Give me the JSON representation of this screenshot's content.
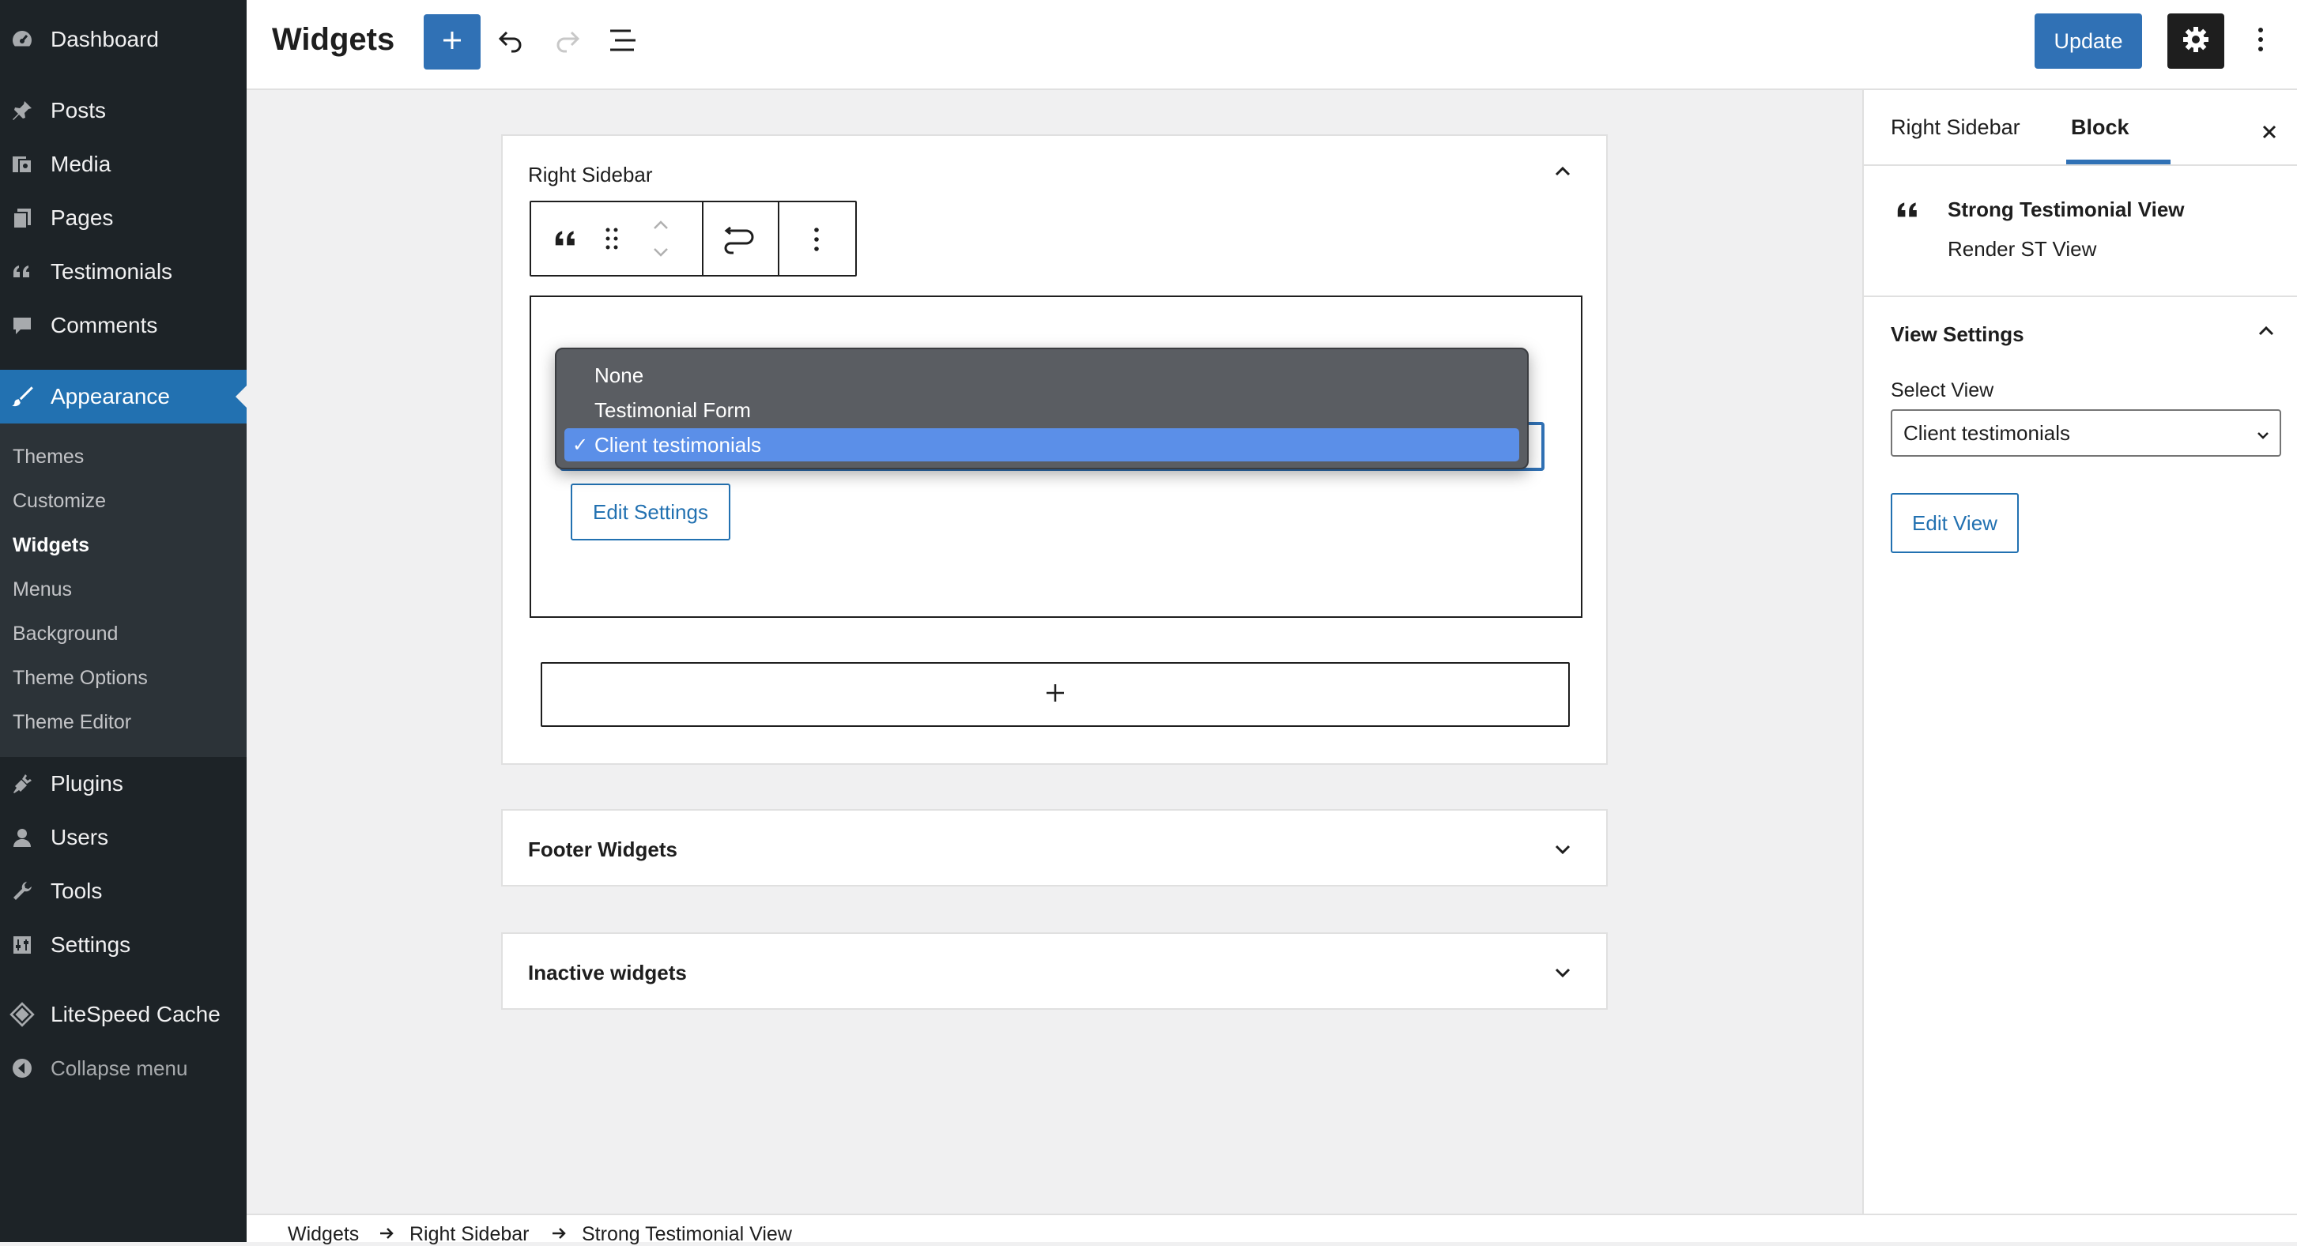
{
  "admin_menu": {
    "items": [
      {
        "label": "Dashboard",
        "icon": "dashboard-icon"
      },
      {
        "label": "Posts",
        "icon": "pin-icon"
      },
      {
        "label": "Media",
        "icon": "media-icon"
      },
      {
        "label": "Pages",
        "icon": "pages-icon"
      },
      {
        "label": "Testimonials",
        "icon": "quote-icon"
      },
      {
        "label": "Comments",
        "icon": "comment-icon"
      },
      {
        "label": "Appearance",
        "icon": "brush-icon",
        "active": true
      },
      {
        "label": "Plugins",
        "icon": "plugin-icon"
      },
      {
        "label": "Users",
        "icon": "user-icon"
      },
      {
        "label": "Tools",
        "icon": "wrench-icon"
      },
      {
        "label": "Settings",
        "icon": "settings-icon"
      },
      {
        "label": "LiteSpeed Cache",
        "icon": "diamond-icon"
      }
    ],
    "submenu": [
      "Themes",
      "Customize",
      "Widgets",
      "Menus",
      "Background",
      "Theme Options",
      "Theme Editor"
    ],
    "current_submenu": "Widgets",
    "collapse_label": "Collapse menu"
  },
  "header": {
    "title": "Widgets",
    "update_label": "Update"
  },
  "editor": {
    "right_sidebar_title": "Right Sidebar",
    "dropdown_options": [
      "None",
      "Testimonial Form",
      "Client testimonials"
    ],
    "dropdown_selected": "Client testimonials",
    "check_mark": "✓",
    "edit_settings_label": "Edit Settings",
    "footer_widgets_title": "Footer Widgets",
    "inactive_widgets_title": "Inactive widgets"
  },
  "settings_sidebar": {
    "tabs": [
      "Right Sidebar",
      "Block"
    ],
    "active_tab": "Block",
    "block_title": "Strong Testimonial View",
    "block_description": "Render ST View",
    "view_settings_title": "View Settings",
    "select_view_label": "Select View",
    "select_view_value": "Client testimonials",
    "edit_view_label": "Edit View"
  },
  "breadcrumb": [
    "Widgets",
    "Right Sidebar",
    "Strong Testimonial View"
  ],
  "colors": {
    "admin_bg": "#1d2327",
    "accent": "#3071b5",
    "dropdown_bg": "#5a5d62",
    "dropdown_selected": "#5b8fe8"
  }
}
